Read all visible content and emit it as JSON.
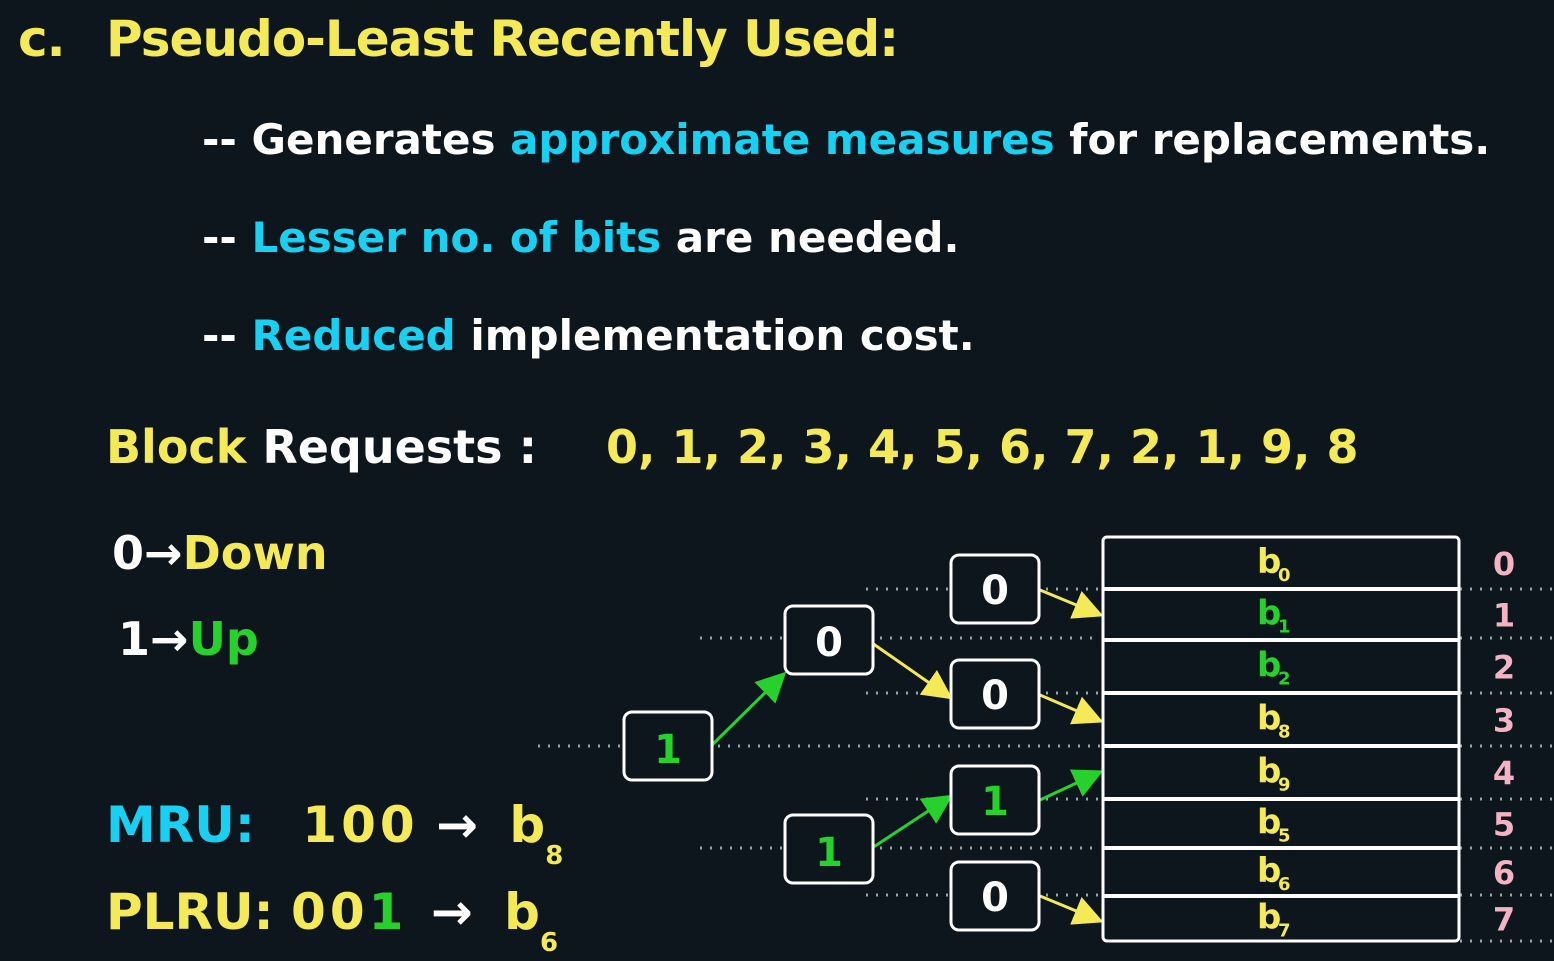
{
  "title": {
    "letter": "c.",
    "text": "Pseudo-Least Recently Used:"
  },
  "bullets": [
    {
      "dash": "--",
      "pre": "Generates ",
      "highlight": "approximate measures",
      "post": " for replacements."
    },
    {
      "dash": "--",
      "pre": "",
      "highlight": "Lesser no. of bits",
      "post": " are needed."
    },
    {
      "dash": "--",
      "pre": "",
      "highlight": "Reduced",
      "post": " implementation cost."
    }
  ],
  "block_requests": {
    "label_a": "Block",
    "label_b": "Requests :",
    "sequence": "0, 1, 2, 3, 4, 5, 6, 7, 2, 1, 9, 8"
  },
  "legend": {
    "down": {
      "bit": "0",
      "arrow": "→",
      "word": "Down"
    },
    "up": {
      "bit": "1",
      "arrow": "→",
      "word": "Up"
    }
  },
  "mru": {
    "label": "MRU:",
    "bits": "100",
    "arrow": "→",
    "block": "b",
    "sub": "8"
  },
  "plru": {
    "label": "PLRU:",
    "bits_a": "00",
    "bits_b": "1",
    "arrow": "→",
    "block": "b",
    "sub": "6"
  },
  "tree_nodes": [
    {
      "id": "root",
      "bit": "1"
    },
    {
      "id": "l1-top",
      "bit": "0"
    },
    {
      "id": "l1-bottom",
      "bit": "1"
    },
    {
      "id": "l2-0",
      "bit": "0"
    },
    {
      "id": "l2-1",
      "bit": "0"
    },
    {
      "id": "l2-2",
      "bit": "1"
    },
    {
      "id": "l2-3",
      "bit": "0"
    }
  ],
  "cache_lines": [
    {
      "index": "0",
      "block": "b",
      "sub": "0",
      "color": "#f4ea57"
    },
    {
      "index": "1",
      "block": "b",
      "sub": "1",
      "color": "#27d12c"
    },
    {
      "index": "2",
      "block": "b",
      "sub": "2",
      "color": "#27d12c"
    },
    {
      "index": "3",
      "block": "b",
      "sub": "8",
      "color": "#f4ea57"
    },
    {
      "index": "4",
      "block": "b",
      "sub": "9",
      "color": "#f4ea57"
    },
    {
      "index": "5",
      "block": "b",
      "sub": "5",
      "color": "#f4ea57"
    },
    {
      "index": "6",
      "block": "b",
      "sub": "6",
      "color": "#f4ea57"
    },
    {
      "index": "7",
      "block": "b",
      "sub": "7",
      "color": "#f4ea57"
    }
  ],
  "colors": {
    "yellow": "#f4ea57",
    "cyan": "#18d1f2",
    "green": "#27d12c",
    "pink": "#f2b3c3",
    "background": "#0d161d"
  }
}
